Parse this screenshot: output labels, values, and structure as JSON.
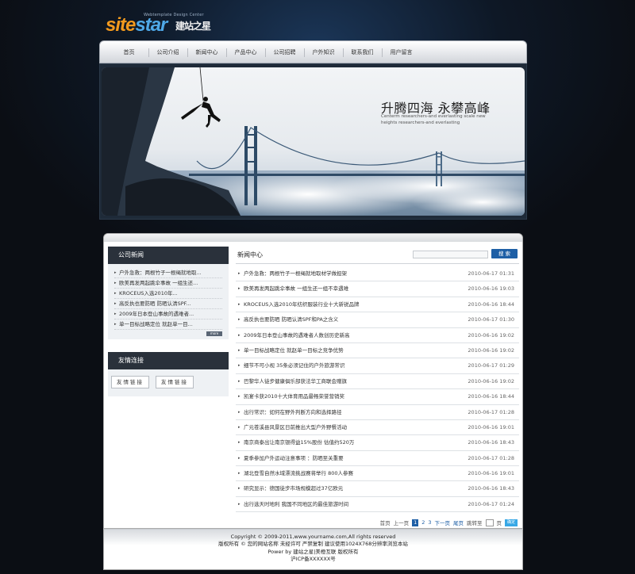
{
  "logo": {
    "main_a": "site",
    "main_b": "star",
    "cn": "建站之星",
    "sub": "Webtemplate Design Center"
  },
  "nav": {
    "items": [
      "首页",
      "公司介绍",
      "新闻中心",
      "产品中心",
      "公司招聘",
      "户外知识",
      "联系我们",
      "用户留言"
    ]
  },
  "banner": {
    "title_cn": "升腾四海 永攀高峰",
    "subtitle_en": "Centerm researchers-and everlasting scale new heights researchers-and everlasting"
  },
  "sidebar": {
    "news_title": "公司新闻",
    "news_items": [
      "户外急救：两根竹子一根绳就地取...",
      "欧美再发两起跳伞事故 一组生还...",
      "KROCEUS入选2010年...",
      "高反执也要防晒 防晒认清SPF...",
      "2009年日本登山事故的遇难者...",
      "单一目标战略定位 就赵单一目..."
    ],
    "more_label": "more",
    "links_title": "友情连接",
    "links": [
      "友情链接",
      "友情链接"
    ]
  },
  "main": {
    "title": "新闻中心",
    "search_placeholder": "",
    "search_button": "搜 索",
    "news": [
      {
        "title": "户外急救：两根竹子一根绳就地取材学做担架",
        "date": "2010-06-17 01:31"
      },
      {
        "title": "欧美再发两起跳伞事故 一组生还一组不幸遇难",
        "date": "2010-06-16 19:03"
      },
      {
        "title": "KROCEUS入选2010年纺织服装行业十大新锐品牌",
        "date": "2010-06-16 18:44"
      },
      {
        "title": "高反执也要防晒 防晒认清SPF和PA之含义",
        "date": "2010-06-17 01:30"
      },
      {
        "title": "2009年日本登山事故的遇难者人数创历史新高",
        "date": "2010-06-16 19:02"
      },
      {
        "title": "单一目标战略定位 就赵单一目标之竞争优势",
        "date": "2010-06-16 19:02"
      },
      {
        "title": "细节不可小视 35条必须记住的户外旅游常识",
        "date": "2010-06-17 01:29"
      },
      {
        "title": "巴黎华人徒步健康俱乐部获法华工商联会赠旗",
        "date": "2010-06-16 19:02"
      },
      {
        "title": "凯宴卡获2010十大体育用品最畅荣誉营销奖",
        "date": "2010-06-16 18:44"
      },
      {
        "title": "出行常识：如何在野外判断方向和选择路径",
        "date": "2010-06-17 01:28"
      },
      {
        "title": "广元苍溪县风景区日前推出大型户外野餐活动",
        "date": "2010-06-16 19:01"
      },
      {
        "title": "南京商泰出让南京银得益15%股份 估值约520万",
        "date": "2010-06-16 18:43"
      },
      {
        "title": "夏季参加户外运动注意事项 ：防晒至关重要",
        "date": "2010-06-17 01:28"
      },
      {
        "title": "湖北登雪自然水域漂流挑战赛将举行 800人参赛",
        "date": "2010-06-16 19:01"
      },
      {
        "title": "研究显示：德国徒步市场规模超过37亿欧元",
        "date": "2010-06-16 18:43"
      },
      {
        "title": "出行选天时地利 我国不同地区的最佳旅游时间",
        "date": "2010-06-17 01:24"
      }
    ]
  },
  "pager": {
    "first": "首页",
    "prev": "上一页",
    "pages": [
      "1",
      "2",
      "3"
    ],
    "current": "1",
    "next": "下一页",
    "last": "尾页",
    "jump_label": "跳转至",
    "page_unit": "页",
    "go": "确定"
  },
  "footer": {
    "line1": "Copyright © 2009-2011,www.yourname.com,All rights reserved",
    "line2": "版权所有 © 您的网站名称 未经许可 严禁复制 建议使用1024X768分辨率浏览本站",
    "line3": "Power by 建站之星|美橙互联 版权所有",
    "line4": "沪ICP备XXXXXX号"
  },
  "colors": {
    "accent": "#1e5fa6",
    "dark_header": "#2a313b",
    "logo_orange": "#f39a1e",
    "logo_blue": "#4fa9e8"
  }
}
